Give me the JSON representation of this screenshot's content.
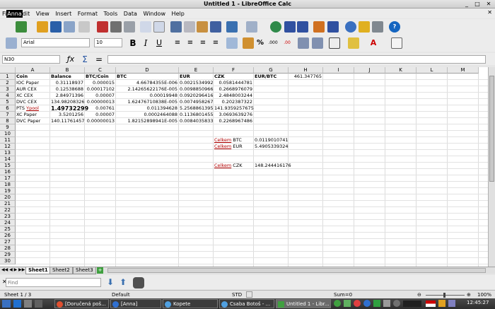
{
  "window": {
    "title": "Untitled 1 - LibreOffice Calc"
  },
  "menu": {
    "file_prefix": "Fi",
    "file_selected": "Anna",
    "edit_suffix": "dit",
    "view": "View",
    "insert": "Insert",
    "format": "Format",
    "tools": "Tools",
    "data": "Data",
    "window": "Window",
    "help": "Help"
  },
  "format": {
    "font_name": "Arial",
    "font_size": "10"
  },
  "formula": {
    "cell_ref": "N30",
    "content": ""
  },
  "columns": [
    "A",
    "B",
    "C",
    "D",
    "E",
    "F",
    "G",
    "H",
    "I",
    "J",
    "K",
    "L",
    "M"
  ],
  "rows": [
    "1",
    "2",
    "3",
    "4",
    "5",
    "6",
    "7",
    "8",
    "9",
    "10",
    "11",
    "12",
    "13",
    "14",
    "15",
    "16",
    "17",
    "18",
    "19",
    "20",
    "21",
    "22",
    "23",
    "24",
    "25",
    "26",
    "27",
    "28",
    "29",
    "30"
  ],
  "cells": {
    "r1": {
      "a": "Coin",
      "b": "Balance",
      "c": "BTC/Coin",
      "d": "BTC",
      "e": "EUR",
      "f": "CZK",
      "g": "EUR/BTC",
      "h": "461.347765"
    },
    "r2": {
      "a": "IOC Paper",
      "b": "0.31118937",
      "c": "0.000015",
      "d": "4.66784355E-006",
      "e": "0.0021534992",
      "f": "0.0581444781"
    },
    "r3": {
      "a": "AUR CEX",
      "b": "0.12538688",
      "c": "0.00017102",
      "d": "2.14265622176E-005",
      "e": "0.0098850966",
      "f": "0.2668976079"
    },
    "r4": {
      "a": "XC CEX",
      "b": "2.84971396",
      "c": "0.00007",
      "d": "0.00019948",
      "e": "0.0920296416",
      "f": "2.4848003244"
    },
    "r5": {
      "a": "DVC CEX",
      "b": "134.98208326",
      "c": "0.00000013",
      "d": "1.62476710838E-005",
      "e": "0.0074958267",
      "f": "0.202387322"
    },
    "r6": {
      "a_prefix": "PTS ",
      "a_link": "Ypool",
      "b": "1.49732299",
      "c": "0.00761",
      "d": "0.011394628",
      "e": "5.2568861395",
      "f": "141.9359257675"
    },
    "r7": {
      "a": "XC Paper",
      "b": "3.5201256",
      "c": "0.00007",
      "d": "0.0002464088",
      "e": "0.1136801455",
      "f": "3.0693639276"
    },
    "r8": {
      "a": "DVC Paper",
      "b": "140.11761457",
      "c": "0.00000013",
      "d": "1.82152898941E-005",
      "e": "0.0084035833",
      "f": "0.2268967486"
    },
    "r11": {
      "f_link": "Celkem",
      "f_rest": " BTC",
      "g": "0.0119010741"
    },
    "r12": {
      "f_link": "Celkem",
      "f_rest": " EUR",
      "g": "5.4905339324"
    },
    "r15": {
      "f_link": "Celkem",
      "f_rest": " CZK",
      "g": "148.244416176"
    }
  },
  "sheets": [
    "Sheet1",
    "Sheet2",
    "Sheet3"
  ],
  "find": {
    "placeholder": "Find"
  },
  "status": {
    "sheet": "Sheet 1 / 3",
    "style": "Default",
    "mode": "STD",
    "sum": "Sum=0",
    "zoom": "100%"
  },
  "taskbar": {
    "items": [
      "[Doručená poš...",
      "[Anna]",
      "Kopete",
      "Csaba Botoš - ...",
      "Untitled 1 - Libr..."
    ],
    "clock": "12:45:27"
  },
  "colors": {
    "accent": "#1565c0",
    "link_red": "#b00000",
    "taskbar": "#2e2e2e"
  }
}
